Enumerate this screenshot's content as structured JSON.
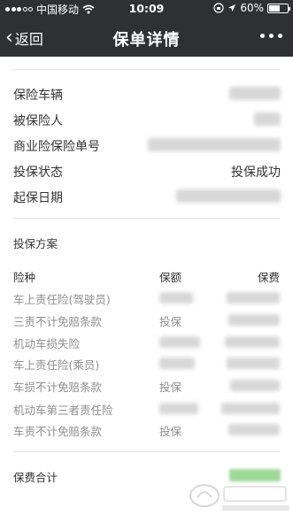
{
  "status_bar": {
    "carrier": "中国移动",
    "time": "10:09",
    "battery": "60%",
    "battery_level": 0.6,
    "icons": [
      "signal-dots-icon",
      "wifi-icon",
      "rotation-lock-icon",
      "location-arrow-icon",
      "battery-icon"
    ]
  },
  "nav": {
    "back_label": "返回",
    "title": "保单详情",
    "more_icon": "more-dots-icon"
  },
  "info": {
    "vehicle_label": "保险车辆",
    "insured_label": "被保险人",
    "policy_no_label": "商业险保险单号",
    "status_label": "投保状态",
    "status_value": "投保成功",
    "start_date_label": "起保日期"
  },
  "plan": {
    "section_title": "投保方案",
    "headers": {
      "name": "险种",
      "amount": "保额",
      "fee": "保费"
    },
    "rows": [
      {
        "name": "车上责任险(驾驶员)",
        "amount": ""
      },
      {
        "name": "三责不计免赔条款",
        "amount": "投保"
      },
      {
        "name": "机动车损失险",
        "amount": ""
      },
      {
        "name": "车上责任险(乘员)",
        "amount": ""
      },
      {
        "name": "车损不计免赔条款",
        "amount": "投保"
      },
      {
        "name": "机动车第三者责任险",
        "amount": ""
      },
      {
        "name": "车责不计免赔条款",
        "amount": "投保"
      }
    ]
  },
  "total": {
    "label": "保费合计"
  },
  "colors": {
    "header_bg": "#2e3033",
    "header_text": "#ffffff",
    "primary_text": "#333333",
    "muted_text": "#8e8e8e",
    "divider": "#e4e4e4",
    "total_highlight": "#9fd99a"
  }
}
